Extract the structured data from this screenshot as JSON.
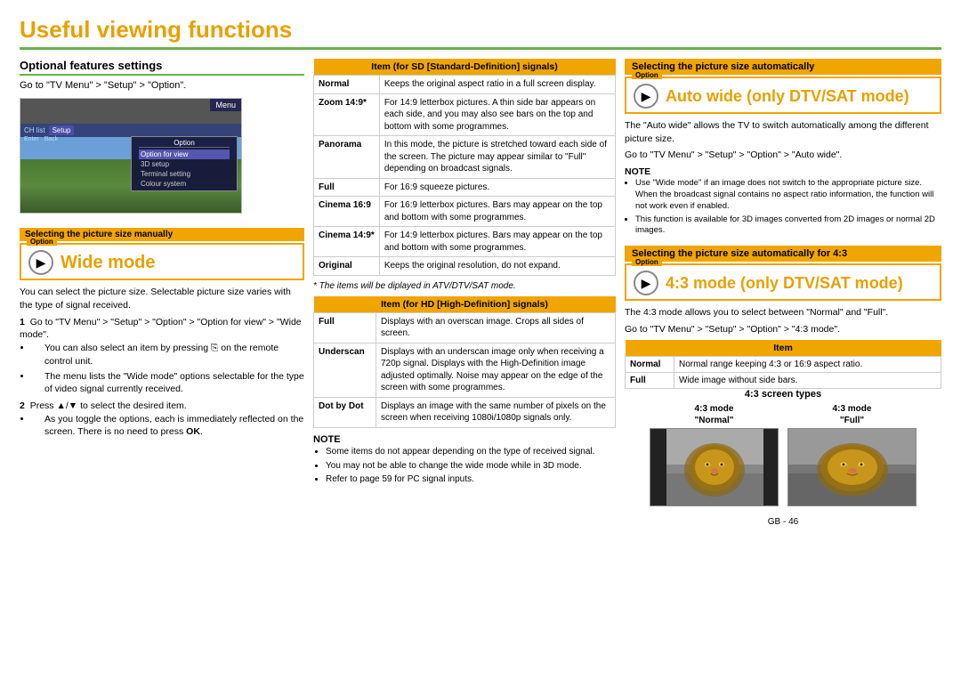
{
  "page": {
    "title": "Useful viewing functions",
    "page_number": "GB - 46"
  },
  "left": {
    "optional_heading": "Optional features settings",
    "go_to": "Go to \"TV Menu\" > \"Setup\" > \"Option\".",
    "tv_menu": {
      "menu_label": "Menu",
      "tab1": "CH list",
      "tab2": "Setup",
      "nav_enter": "Enter",
      "nav_back": "Back",
      "option_title": "Option",
      "items": [
        "Option for view",
        "3D setup",
        "Terminal setting",
        "Colour system"
      ],
      "highlighted": "Option for view"
    },
    "wide_mode_banner": "Selecting the picture size manually",
    "option_label": "Option",
    "wide_mode_title": "Wide mode",
    "wide_mode_body": "You can select the picture size. Selectable picture size varies with the type of signal received.",
    "steps": [
      {
        "num": "1",
        "text": "Go to \"TV Menu\" > \"Setup\" > \"Option\" > \"Option for view\" > \"Wide mode\".",
        "bullets": [
          "You can also select an item by pressing  on the remote control unit.",
          "The menu lists the \"Wide mode\" options selectable for the type of video signal currently received."
        ]
      },
      {
        "num": "2",
        "text": "Press ▲/▼ to select the desired item.",
        "bullets": [
          "As you toggle the options, each is immediately reflected on the screen. There is no need to press OK."
        ]
      }
    ]
  },
  "middle": {
    "sd_table": {
      "header": "Item (for SD [Standard-Definition] signals)",
      "rows": [
        {
          "item": "Normal",
          "desc": "Keeps the original aspect ratio in a full screen display."
        },
        {
          "item": "Zoom 14:9*",
          "desc": "For 14:9 letterbox pictures. A thin side bar appears on each side, and you may also see bars on the top and bottom with some programmes."
        },
        {
          "item": "Panorama",
          "desc": "In this mode, the picture is stretched toward each side of the screen. The picture may appear similar to \"Full\" depending on broadcast signals."
        },
        {
          "item": "Full",
          "desc": "For 16:9 squeeze pictures."
        },
        {
          "item": "Cinema 16:9",
          "desc": "For 16:9 letterbox pictures. Bars may appear on the top and bottom with some programmes."
        },
        {
          "item": "Cinema 14:9*",
          "desc": "For 14:9 letterbox pictures. Bars may appear on the top and bottom with some programmes."
        },
        {
          "item": "Original",
          "desc": "Keeps the original resolution, do not expand."
        }
      ],
      "footnote": "* The items will be diplayed in ATV/DTV/SAT mode."
    },
    "hd_table": {
      "header": "Item (for HD [High-Definition] signals)",
      "rows": [
        {
          "item": "Full",
          "desc": "Displays with an overscan image. Crops all sides of screen."
        },
        {
          "item": "Underscan",
          "desc": "Displays with an underscan image only when receiving a 720p signal. Displays with the High-Definition image adjusted optimally. Noise may appear on the edge of the screen with some programmes."
        },
        {
          "item": "Dot by Dot",
          "desc": "Displays an image with the same number of pixels on the screen when receiving 1080i/1080p signals only."
        }
      ]
    },
    "note": {
      "title": "NOTE",
      "bullets": [
        "Some items do not appear depending on the type of received signal.",
        "You may not be able to change the wide mode while in 3D mode.",
        "Refer to page 59 for PC signal inputs."
      ]
    }
  },
  "right": {
    "auto_wide_banner": "Selecting the picture size automatically",
    "option_label": "Option",
    "auto_wide_title": "Auto wide (only DTV/SAT mode)",
    "auto_wide_body1": "The \"Auto wide\" allows the TV to switch automatically among the different picture size.",
    "auto_wide_body2": "Go to \"TV Menu\" > \"Setup\" > \"Option\" > \"Auto wide\".",
    "auto_wide_note": {
      "title": "NOTE",
      "bullets": [
        "Use \"Wide mode\" if an image does not switch to the appropriate picture size. When the broadcast signal contains no aspect ratio information, the function will not work even if enabled.",
        "This function is available for 3D images converted from 2D images or normal 2D images."
      ]
    },
    "four_three_banner": "Selecting the picture size automatically for 4:3",
    "option_label2": "Option",
    "four_three_title": "4:3 mode (only DTV/SAT mode)",
    "four_three_body1": "The 4:3 mode allows you to select between \"Normal\" and \"Full\".",
    "four_three_body2": "Go to \"TV Menu\" > \"Setup\" > \"Option\" > \"4:3 mode\".",
    "four_three_table": {
      "header": "Item",
      "rows": [
        {
          "item": "Normal",
          "desc": "Normal range keeping 4:3 or 16:9 aspect ratio."
        },
        {
          "item": "Full",
          "desc": "Wide image without side bars."
        }
      ]
    },
    "screen_types_heading": "4:3 screen types",
    "screen_label1_line1": "4:3 mode",
    "screen_label1_line2": "\"Normal\"",
    "screen_label2_line1": "4:3 mode",
    "screen_label2_line2": "\"Full\""
  }
}
